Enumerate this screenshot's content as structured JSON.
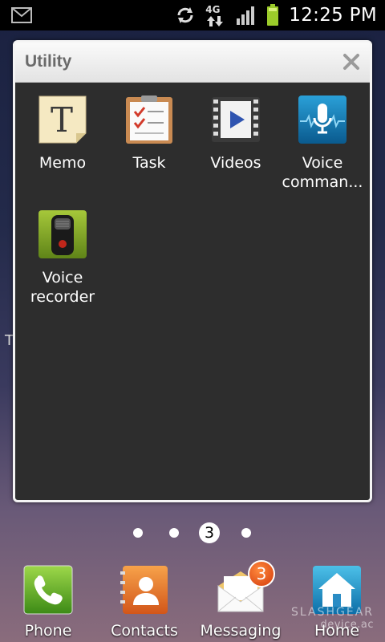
{
  "status_bar": {
    "time": "12:25 PM",
    "network": "4G",
    "icons": [
      "gmail-icon",
      "sync-icon",
      "4g-data-icon",
      "signal-icon",
      "battery-icon"
    ]
  },
  "folder": {
    "title": "Utility",
    "apps": [
      {
        "label": "Memo",
        "icon": "memo-icon"
      },
      {
        "label": "Task",
        "icon": "task-icon"
      },
      {
        "label": "Videos",
        "icon": "videos-icon"
      },
      {
        "label": "Voice\ncomman...",
        "icon": "voice-command-icon"
      },
      {
        "label": "Voice\nrecorder",
        "icon": "voice-recorder-icon"
      }
    ]
  },
  "edge_text": "T",
  "pager": {
    "current_page": "3"
  },
  "dock": [
    {
      "label": "Phone",
      "icon": "phone-icon"
    },
    {
      "label": "Contacts",
      "icon": "contacts-icon"
    },
    {
      "label": "Messaging",
      "icon": "messaging-icon",
      "badge": "3"
    },
    {
      "label": "Home",
      "icon": "home-icon"
    }
  ],
  "watermark": {
    "line1": "SLASHGEAR",
    "line2": "device.ac"
  }
}
